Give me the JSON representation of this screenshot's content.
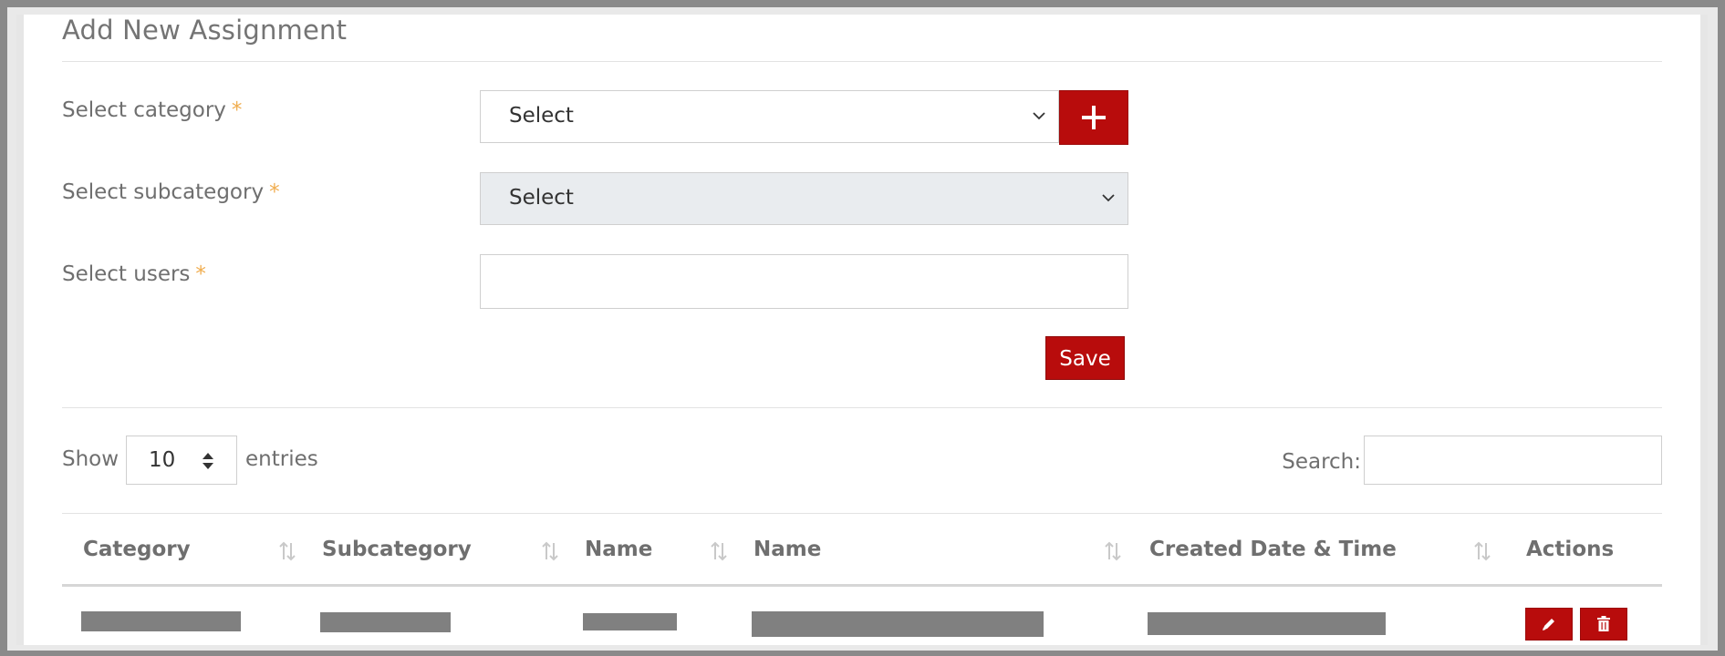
{
  "form": {
    "title": "Add New Assignment",
    "category_label": "Select category",
    "subcategory_label": "Select subcategory",
    "users_label": "Select users",
    "required_mark": "*",
    "category_value": "Select",
    "subcategory_value": "Select",
    "users_value": "",
    "save_label": "Save"
  },
  "table_controls": {
    "show_label": "Show",
    "page_length": "10",
    "entries_label": "entries",
    "search_label": "Search:",
    "search_value": ""
  },
  "table": {
    "columns": [
      "Category",
      "Subcategory",
      "Name",
      "Name",
      "Created Date & Time",
      "Actions"
    ]
  },
  "colors": {
    "accent": "#b80c0c",
    "required": "#f0ad4e"
  }
}
